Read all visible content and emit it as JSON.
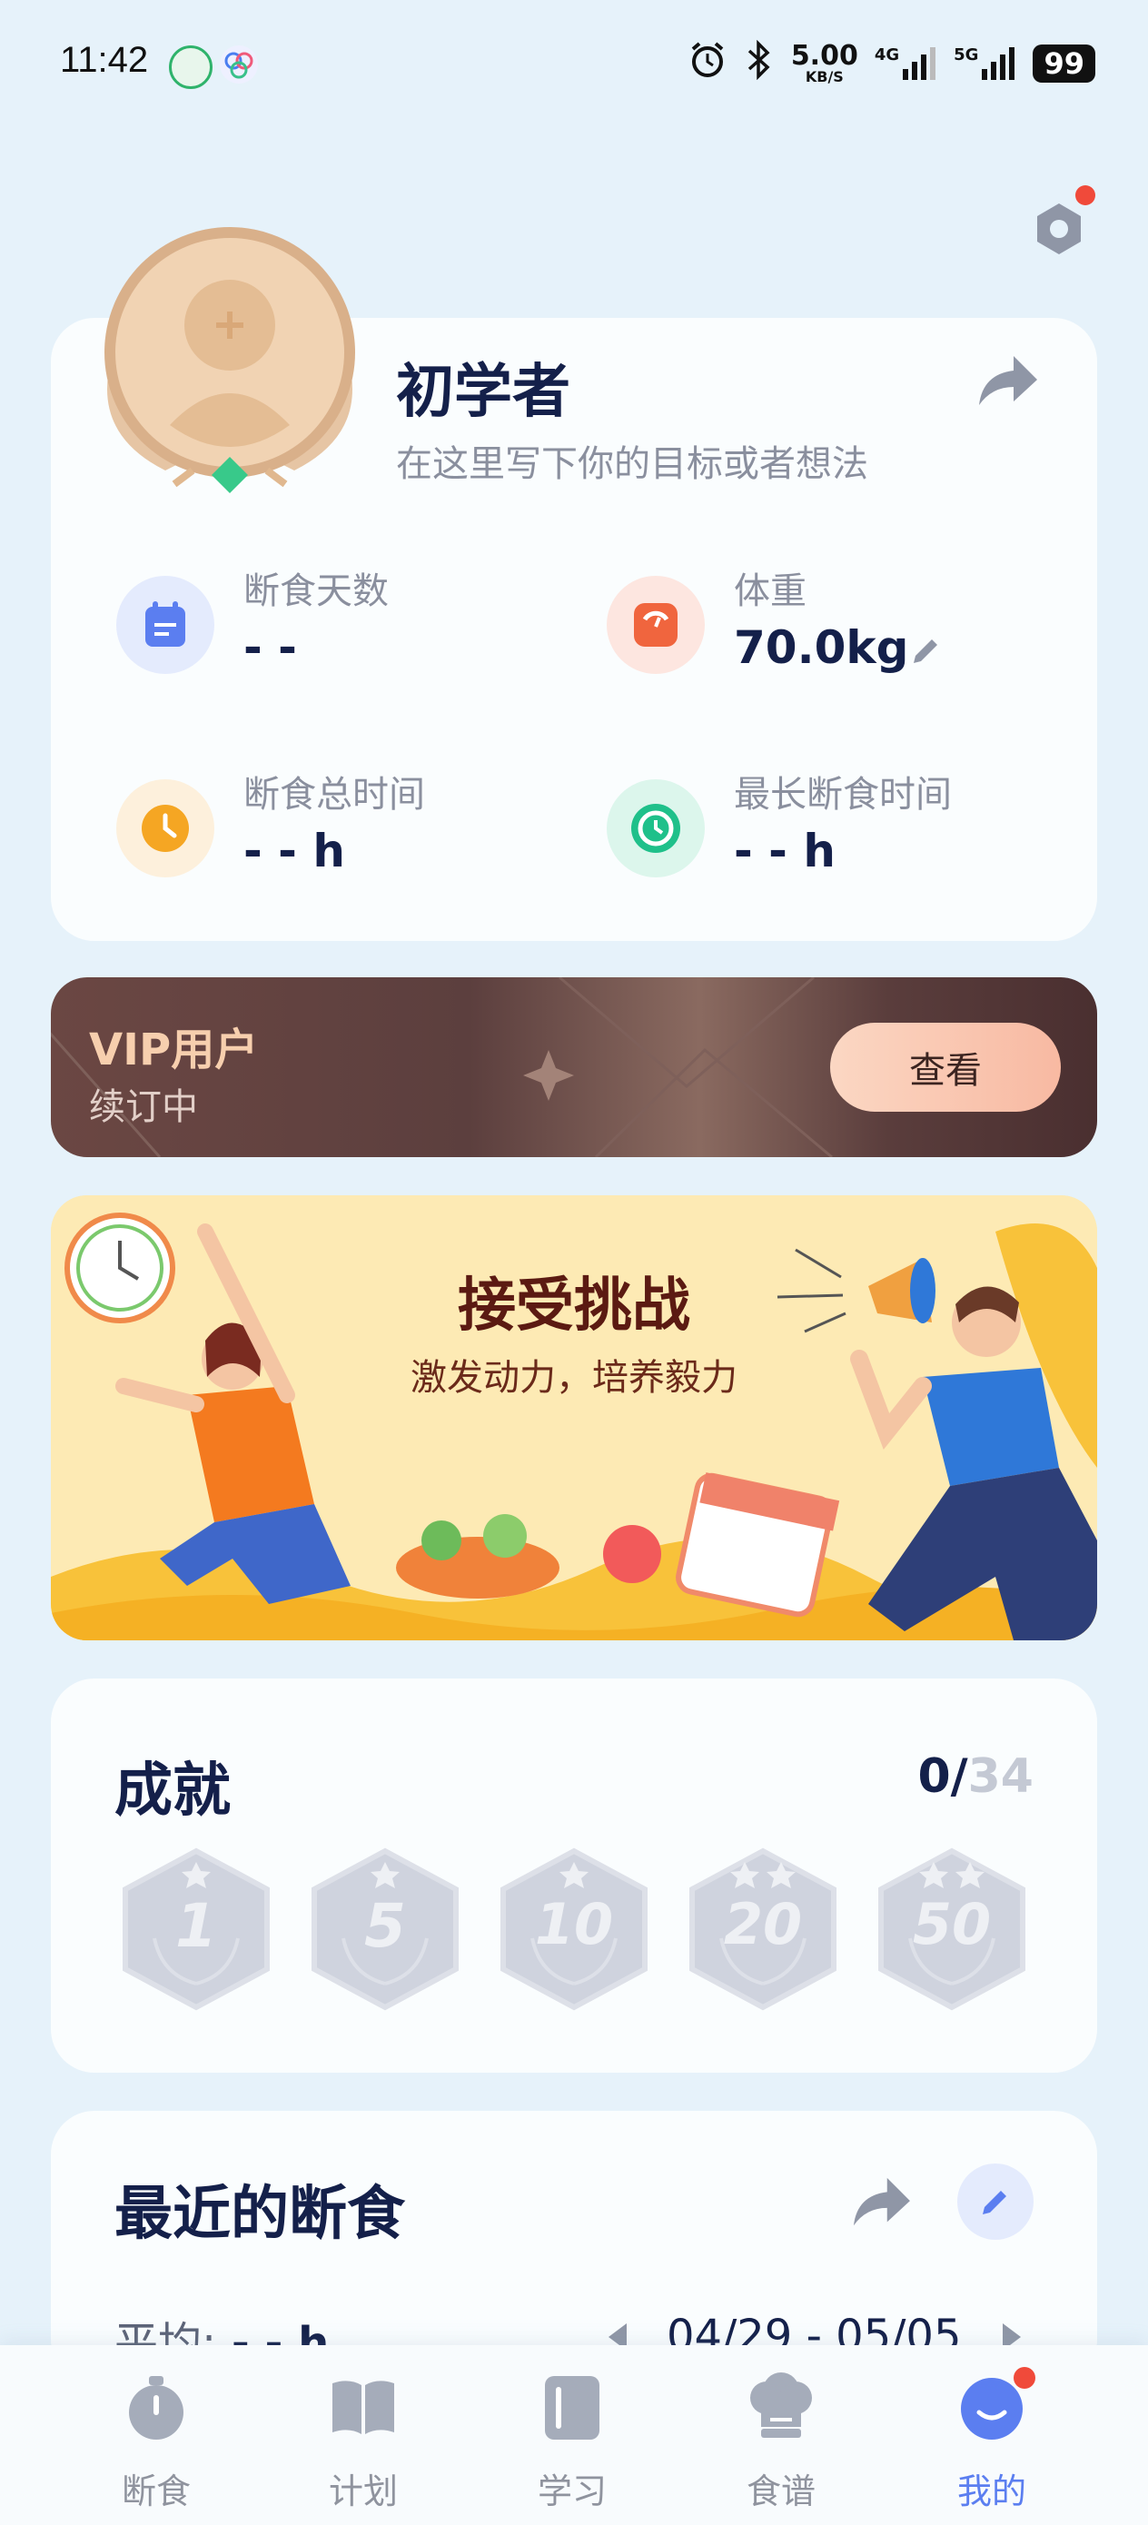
{
  "status_bar": {
    "time": "11:42",
    "net_speed": "5.00",
    "net_unit": "KB/S",
    "signal_1": "4G",
    "signal_2": "5G",
    "battery": "99"
  },
  "profile": {
    "name": "初学者",
    "motto_placeholder": "在这里写下你的目标或者想法"
  },
  "stats": {
    "fast_days_label": "断食天数",
    "fast_days_value": "- -",
    "weight_label": "体重",
    "weight_value": "70.0kg",
    "total_time_label": "断食总时间",
    "total_time_value": "- - h",
    "longest_label": "最长断食时间",
    "longest_value": "- - h"
  },
  "vip": {
    "title": "VIP用户",
    "subtitle": "续订中",
    "button": "查看"
  },
  "challenge": {
    "title": "接受挑战",
    "subtitle": "激发动力，培养毅力"
  },
  "achievements": {
    "title": "成就",
    "count_done": "0/",
    "count_total": "34",
    "badges": [
      "1",
      "5",
      "10",
      "20",
      "50"
    ]
  },
  "recent": {
    "title": "最近的断食",
    "avg_label": "平均:",
    "avg_value": "- - h",
    "date_range": "04/29 - 05/05"
  },
  "nav": {
    "items": [
      "断食",
      "计划",
      "学习",
      "食谱",
      "我的"
    ],
    "active_index": 4
  },
  "colors": {
    "background": "#e6f2fa",
    "accent": "#5b7ef0",
    "notification": "#f04a3a",
    "vip_button": "#fbc9b0"
  }
}
